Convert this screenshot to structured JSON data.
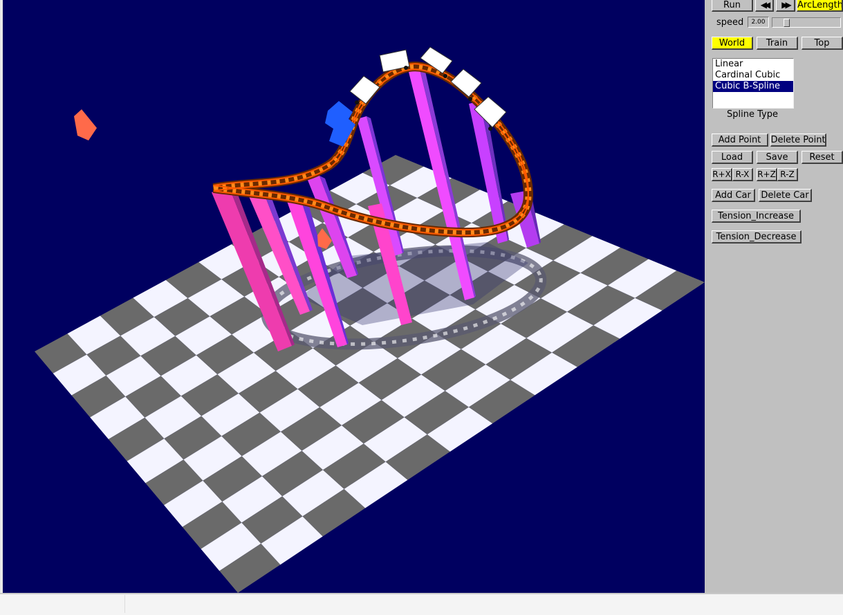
{
  "controls": {
    "run_label": "Run",
    "rewind_icon": "rewind-icon",
    "fastforward_icon": "fast-forward-icon",
    "arclength_label": "ArcLength",
    "speed_label": "speed",
    "speed_value": "2.00",
    "speed_fraction": 0.18
  },
  "view": {
    "world_label": "World",
    "train_label": "Train",
    "top_label": "Top",
    "selected": "World"
  },
  "spline": {
    "options": [
      "Linear",
      "Cardinal Cubic",
      "Cubic B-Spline"
    ],
    "selected": "Cubic B-Spline",
    "caption": "Spline Type"
  },
  "buttons": {
    "add_point": "Add Point",
    "delete_point": "Delete Point",
    "load": "Load",
    "save": "Save",
    "reset": "Reset",
    "rpx": "R+X",
    "rmx": "R-X",
    "rpz": "R+Z",
    "rmz": "R-Z",
    "add_car": "Add Car",
    "delete_car": "Delete Car",
    "tension_increase": "Tension_Increase",
    "tension_decrease": "Tension_Decrease"
  },
  "colors": {
    "sky": "#000060",
    "highlight": "#ffff00",
    "panel": "#c0c0c0",
    "track": "#ff6600",
    "pillar": "#ff44cc",
    "selected_point": "#1f5fff"
  }
}
